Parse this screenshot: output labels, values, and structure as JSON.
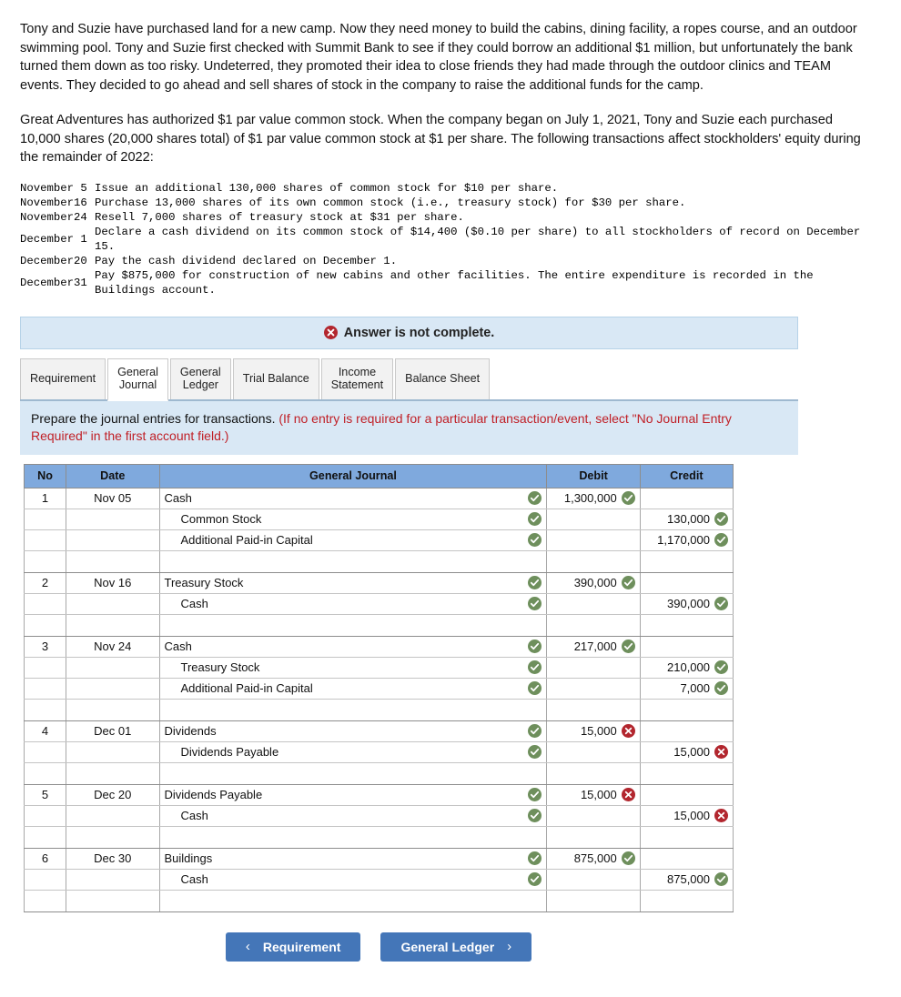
{
  "narrative": {
    "p1": "Tony and Suzie have purchased land for a new camp. Now they need money to build the cabins, dining facility, a ropes course, and an outdoor swimming pool. Tony and Suzie first checked with Summit Bank to see if they could borrow an additional $1 million, but unfortunately the bank turned them down as too risky. Undeterred, they promoted their idea to close friends they had made through the outdoor clinics and TEAM events. They decided to go ahead and sell shares of stock in the company to raise the additional funds for the camp.",
    "p2": "Great Adventures has authorized $1 par value common stock. When the company began on July 1, 2021, Tony and Suzie each purchased 10,000 shares (20,000 shares total) of $1 par value common stock at $1 per share. The following transactions affect stockholders' equity during the remainder of 2022:"
  },
  "transactions": [
    {
      "date": "November 5",
      "text": "Issue an additional 130,000 shares of common stock for $10 per share."
    },
    {
      "date": "November16",
      "text": "Purchase 13,000 shares of its own common stock (i.e., treasury stock) for $30 per share."
    },
    {
      "date": "November24",
      "text": "Resell 7,000 shares of treasury stock at $31 per share."
    },
    {
      "date": "December 1",
      "text": "Declare a cash dividend on its common stock of $14,400 ($0.10 per share) to all stockholders of record on December 15."
    },
    {
      "date": "December20",
      "text": "Pay the cash dividend declared on December 1."
    },
    {
      "date": "December31",
      "text": "Pay $875,000 for construction of new cabins and other facilities. The entire expenditure is recorded in the Buildings account."
    }
  ],
  "alert": {
    "text": "Answer is not complete.",
    "icon": "x-circle-icon",
    "background": "#d9e8f5"
  },
  "tabs": [
    {
      "label": "Requirement",
      "active": false
    },
    {
      "label": "General\nJournal",
      "active": true
    },
    {
      "label": "General\nLedger",
      "active": false
    },
    {
      "label": "Trial Balance",
      "active": false
    },
    {
      "label": "Income\nStatement",
      "active": false
    },
    {
      "label": "Balance Sheet",
      "active": false
    }
  ],
  "instructions": {
    "main": "Prepare the journal entries for transactions. ",
    "hint": "(If no entry is required for a particular transaction/event, select \"No Journal Entry Required\" in the first account field.)"
  },
  "table": {
    "headers": [
      "No",
      "Date",
      "General Journal",
      "Debit",
      "Credit"
    ],
    "rows": [
      {
        "no": "1",
        "date": "Nov 05",
        "account": "Cash",
        "indent": 0,
        "acct_mark": "ok",
        "debit": "1,300,000",
        "debit_mark": "ok",
        "credit": "",
        "credit_mark": ""
      },
      {
        "no": "",
        "date": "",
        "account": "Common Stock",
        "indent": 1,
        "acct_mark": "ok",
        "debit": "",
        "debit_mark": "",
        "credit": "130,000",
        "credit_mark": "ok"
      },
      {
        "no": "",
        "date": "",
        "account": "Additional Paid-in Capital",
        "indent": 1,
        "acct_mark": "ok",
        "debit": "",
        "debit_mark": "",
        "credit": "1,170,000",
        "credit_mark": "ok"
      },
      {
        "spacer": true
      },
      {
        "no": "2",
        "date": "Nov 16",
        "account": "Treasury Stock",
        "indent": 0,
        "acct_mark": "ok",
        "debit": "390,000",
        "debit_mark": "ok",
        "credit": "",
        "credit_mark": ""
      },
      {
        "no": "",
        "date": "",
        "account": "Cash",
        "indent": 1,
        "acct_mark": "ok",
        "debit": "",
        "debit_mark": "",
        "credit": "390,000",
        "credit_mark": "ok"
      },
      {
        "spacer": true
      },
      {
        "no": "3",
        "date": "Nov 24",
        "account": "Cash",
        "indent": 0,
        "acct_mark": "ok",
        "debit": "217,000",
        "debit_mark": "ok",
        "credit": "",
        "credit_mark": ""
      },
      {
        "no": "",
        "date": "",
        "account": "Treasury Stock",
        "indent": 1,
        "acct_mark": "ok",
        "debit": "",
        "debit_mark": "",
        "credit": "210,000",
        "credit_mark": "ok"
      },
      {
        "no": "",
        "date": "",
        "account": "Additional Paid-in Capital",
        "indent": 1,
        "acct_mark": "ok",
        "debit": "",
        "debit_mark": "",
        "credit": "7,000",
        "credit_mark": "ok"
      },
      {
        "spacer": true
      },
      {
        "no": "4",
        "date": "Dec 01",
        "account": "Dividends",
        "indent": 0,
        "acct_mark": "ok",
        "debit": "15,000",
        "debit_mark": "bad",
        "credit": "",
        "credit_mark": ""
      },
      {
        "no": "",
        "date": "",
        "account": "Dividends Payable",
        "indent": 1,
        "acct_mark": "ok",
        "debit": "",
        "debit_mark": "",
        "credit": "15,000",
        "credit_mark": "bad"
      },
      {
        "spacer": true
      },
      {
        "no": "5",
        "date": "Dec 20",
        "account": "Dividends Payable",
        "indent": 0,
        "acct_mark": "ok",
        "debit": "15,000",
        "debit_mark": "bad",
        "credit": "",
        "credit_mark": ""
      },
      {
        "no": "",
        "date": "",
        "account": "Cash",
        "indent": 1,
        "acct_mark": "ok",
        "debit": "",
        "debit_mark": "",
        "credit": "15,000",
        "credit_mark": "bad"
      },
      {
        "spacer": true
      },
      {
        "no": "6",
        "date": "Dec 30",
        "account": "Buildings",
        "indent": 0,
        "acct_mark": "ok",
        "debit": "875,000",
        "debit_mark": "ok",
        "credit": "",
        "credit_mark": ""
      },
      {
        "no": "",
        "date": "",
        "account": "Cash",
        "indent": 1,
        "acct_mark": "ok",
        "debit": "",
        "debit_mark": "",
        "credit": "875,000",
        "credit_mark": "ok"
      },
      {
        "spacer": true
      }
    ]
  },
  "footer": {
    "prev": {
      "label": "Requirement",
      "chevron": "‹"
    },
    "next": {
      "label": "General Ledger",
      "chevron": "›"
    }
  },
  "colors": {
    "header_blue": "#7fa9dd",
    "band_blue": "#d9e8f5",
    "button_blue": "#4476b8",
    "ok_green": "#6e8f5c",
    "error_red": "#b2262e",
    "hint_red": "#c01f26"
  }
}
